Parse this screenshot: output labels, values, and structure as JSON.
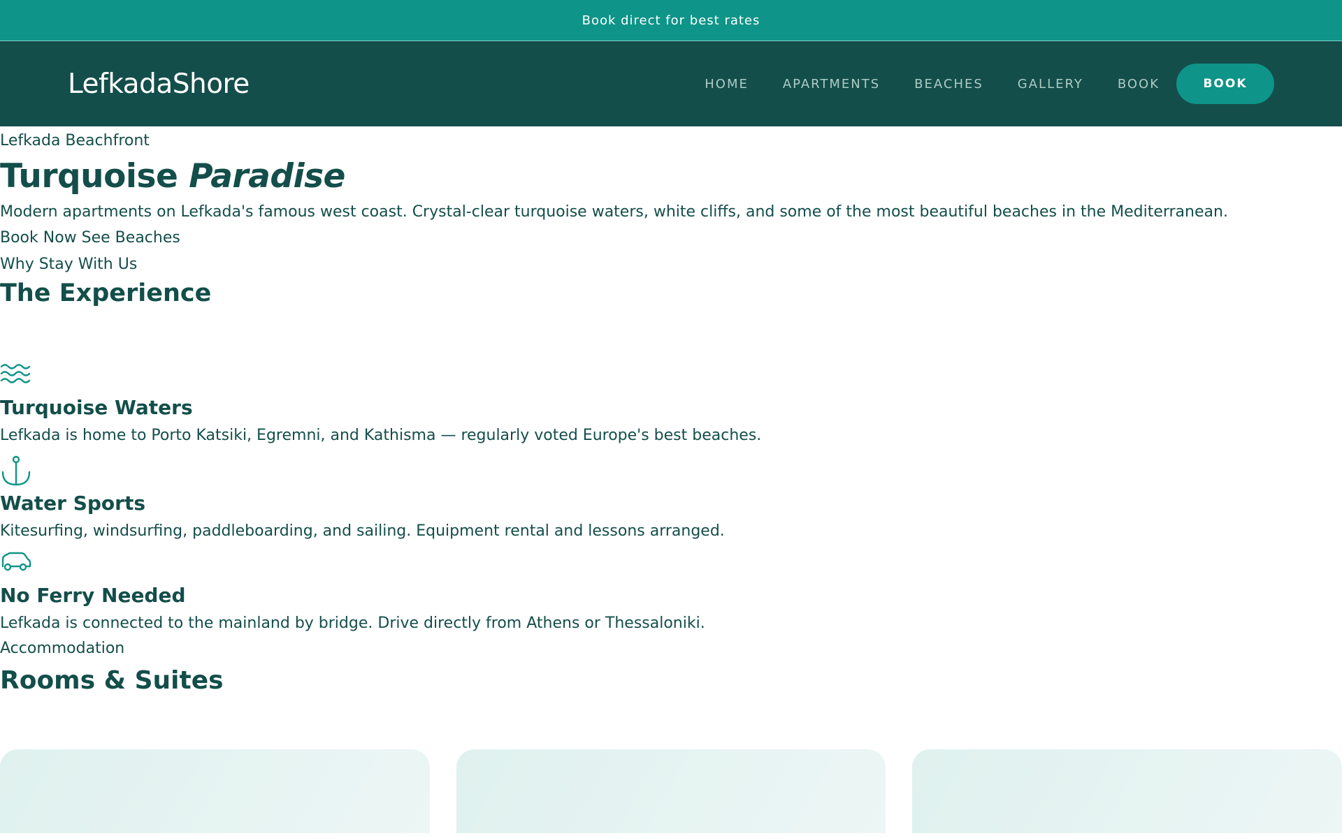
{
  "topbar": {
    "text": "Book direct for best rates"
  },
  "nav": {
    "logo": "LefkadaShore",
    "links": [
      "HOME",
      "APARTMENTS",
      "BEACHES",
      "GALLERY",
      "BOOK"
    ],
    "cta": "BOOK"
  },
  "hero": {
    "eyebrow": "Lefkada Beachfront",
    "title_main": "Turquoise",
    "title_em": "Paradise",
    "subtitle": "Modern apartments on Lefkada's famous west coast. Crystal-clear turquoise waters, white cliffs, and some of the most beautiful beaches in the Mediterranean.",
    "cta_primary": "Book Now",
    "cta_secondary": "See Beaches"
  },
  "experience": {
    "eyebrow": "Why Stay With Us",
    "title": "The Experience",
    "features": [
      {
        "icon": "waves-icon",
        "title": "Turquoise Waters",
        "desc": "Lefkada is home to Porto Katsiki, Egremni, and Kathisma — regularly voted Europe's best beaches."
      },
      {
        "icon": "anchor-icon",
        "title": "Water Sports",
        "desc": "Kitesurfing, windsurfing, paddleboarding, and sailing. Equipment rental and lessons arranged."
      },
      {
        "icon": "car-icon",
        "title": "No Ferry Needed",
        "desc": "Lefkada is connected to the mainland by bridge. Drive directly from Athens or Thessaloniki."
      }
    ]
  },
  "rooms": {
    "eyebrow": "Accommodation",
    "title": "Rooms & Suites"
  },
  "colors": {
    "primary": "#0e9488",
    "dark": "#134e4a",
    "nav_link": "#aecbc6"
  }
}
